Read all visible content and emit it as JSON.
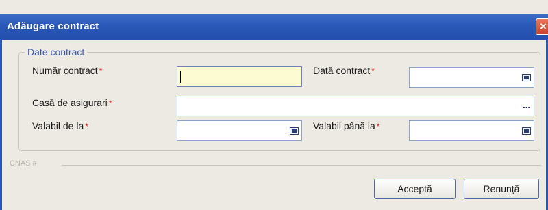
{
  "window": {
    "title": "Adăugare contract"
  },
  "group": {
    "legend": "Date contract"
  },
  "fields": {
    "numar_contract": {
      "label": "Număr contract",
      "value": ""
    },
    "data_contract": {
      "label": "Dată contract",
      "value": ""
    },
    "casa_asigurari": {
      "label": "Casă de asigurari",
      "value": ""
    },
    "valabil_de_la": {
      "label": "Valabil de la",
      "value": ""
    },
    "valabil_pana_la": {
      "label": "Valabil până la",
      "value": ""
    },
    "required_mark": "*"
  },
  "cnas": {
    "label": "CNAS #"
  },
  "buttons": {
    "accept": "Acceptă",
    "cancel": "Renunță"
  },
  "icons": {
    "close": "close-icon",
    "calendar": "calendar-icon",
    "browse": "ellipsis-icon"
  }
}
